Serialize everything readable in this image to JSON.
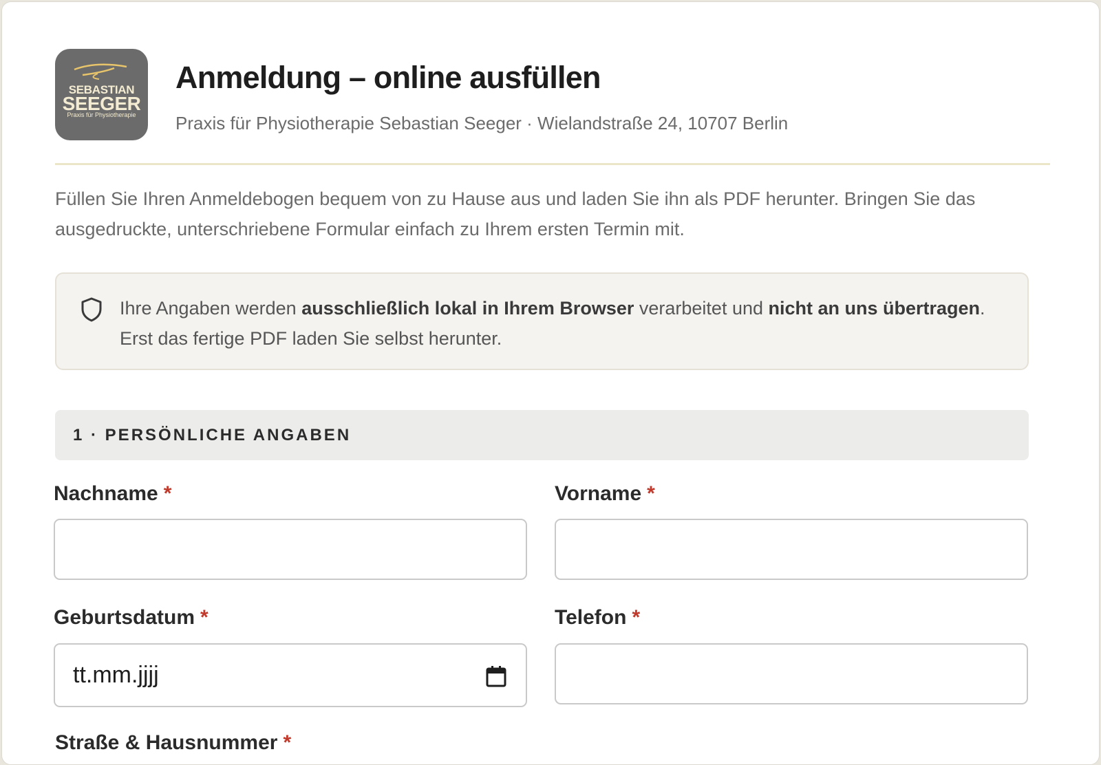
{
  "header": {
    "logo": {
      "line1": "SEBASTIAN",
      "line2": "SEEGER",
      "line3": "Praxis für Physiotherapie"
    },
    "title": "Anmeldung – online ausfüllen",
    "subtitle": "Praxis für Physiotherapie Sebastian Seeger · Wielandstraße 24, 10707 Berlin"
  },
  "intro": "Füllen Sie Ihren Anmeldebogen bequem von zu Hause aus und laden Sie ihn als PDF herunter. Bringen Sie das ausgedruckte, unterschriebene Formular einfach zu Ihrem ersten Termin mit.",
  "notice": {
    "icon": "shield-icon",
    "part1": "Ihre Angaben werden ",
    "bold1": "ausschließlich lokal in Ihrem Browser",
    "part2": " verarbeitet und ",
    "bold2": "nicht an uns übertragen",
    "part3": ". Erst das fertige PDF laden Sie selbst herunter."
  },
  "section1": {
    "title": "1 · PERSÖNLICHE ANGABEN"
  },
  "fields": {
    "nachname": {
      "label": "Nachname",
      "required": "*",
      "value": ""
    },
    "vorname": {
      "label": "Vorname",
      "required": "*",
      "value": ""
    },
    "geburtsdatum": {
      "label": "Geburtsdatum",
      "required": "*",
      "placeholder": "tt.mm.jjjj",
      "icon": "calendar-icon"
    },
    "telefon": {
      "label": "Telefon",
      "required": "*",
      "value": ""
    },
    "strasse": {
      "label": "Straße & Hausnummer",
      "required": "*"
    }
  },
  "colors": {
    "accent_line": "#ece6c9",
    "required": "#c0392b",
    "logo_bg": "#6b6b6b",
    "logo_text": "#f4ecd2"
  }
}
